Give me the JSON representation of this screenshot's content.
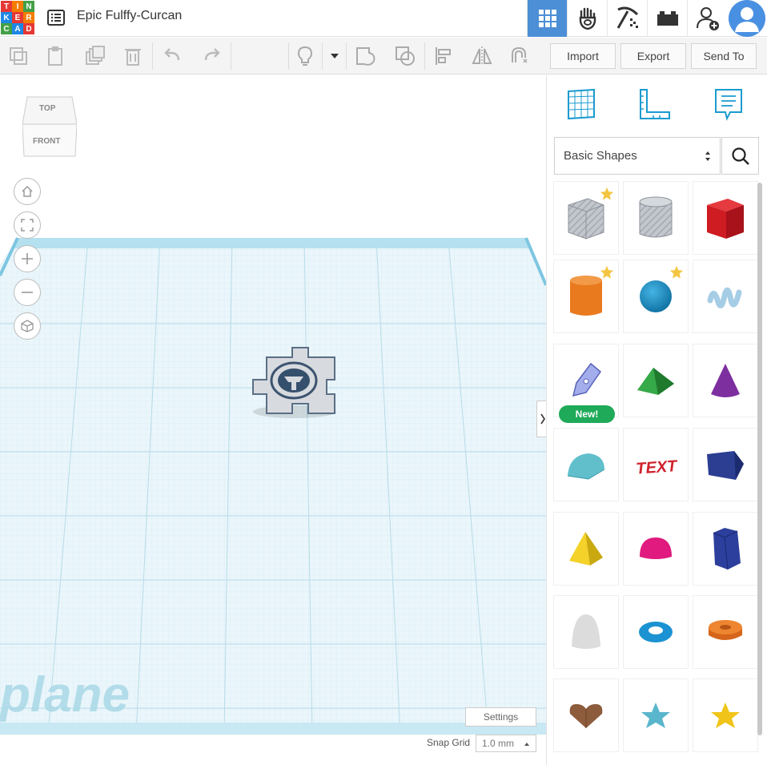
{
  "app": {
    "logo_letters": [
      "T",
      "I",
      "N",
      "K",
      "E",
      "R",
      "C",
      "A",
      "D"
    ],
    "doc_title": "Epic Fulffy-Curcan"
  },
  "topnav": {
    "icons": [
      "grid-view-icon",
      "gallery-hand-icon",
      "pickaxe-icon",
      "bricks-icon",
      "add-user-icon",
      "user-avatar"
    ]
  },
  "toolbar": {
    "buttons": [
      "copy-icon",
      "paste-icon",
      "duplicate-icon",
      "delete-icon",
      "undo-icon",
      "redo-icon",
      "light-bulb-icon",
      "dropdown-icon",
      "group-icon",
      "ungroup-icon",
      "align-icon",
      "mirror-icon",
      "magnet-icon"
    ],
    "import_label": "Import",
    "export_label": "Export",
    "send_to_label": "Send To"
  },
  "viewcube": {
    "top_label": "TOP",
    "front_label": "FRONT"
  },
  "workplane": {
    "plane_label": "plane",
    "settings_label": "Settings",
    "snap_label": "Snap Grid",
    "snap_value": "1.0 mm"
  },
  "panel": {
    "category": "Basic Shapes",
    "new_badge": "New!",
    "shapes": [
      {
        "name": "box-striped",
        "color": "#b7bcc4",
        "star": true
      },
      {
        "name": "cylinder-striped",
        "color": "#c0c4ca",
        "star": false
      },
      {
        "name": "box",
        "color": "#d1141f",
        "star": false
      },
      {
        "name": "cylinder",
        "color": "#e8781c",
        "star": true
      },
      {
        "name": "sphere",
        "color": "#1590c6",
        "star": true
      },
      {
        "name": "scribble",
        "color": "#9ec7e3",
        "star": false
      },
      {
        "name": "pen-tool",
        "color": "#8e9ae0",
        "star": false,
        "new": true
      },
      {
        "name": "roof",
        "color": "#2ea13e",
        "star": false
      },
      {
        "name": "cone",
        "color": "#7a2d9b",
        "star": false
      },
      {
        "name": "round-roof",
        "color": "#5bbcc9",
        "star": false
      },
      {
        "name": "text",
        "color": "#d0212b",
        "star": false
      },
      {
        "name": "wedge",
        "color": "#2b3f8f",
        "star": false
      },
      {
        "name": "pyramid",
        "color": "#f2cc1a",
        "star": false
      },
      {
        "name": "half-sphere",
        "color": "#e0187c",
        "star": false
      },
      {
        "name": "polygon",
        "color": "#2c3e9a",
        "star": false
      },
      {
        "name": "paraboloid",
        "color": "#d7d7d7",
        "star": false
      },
      {
        "name": "torus",
        "color": "#1a8fcf",
        "star": false
      },
      {
        "name": "tube",
        "color": "#e6741a",
        "star": false
      },
      {
        "name": "heart",
        "color": "#8a5a3c",
        "star": false
      },
      {
        "name": "star-shape",
        "color": "#5ab3c9",
        "star": false
      },
      {
        "name": "star-gold",
        "color": "#f0c419",
        "star": false
      }
    ]
  }
}
